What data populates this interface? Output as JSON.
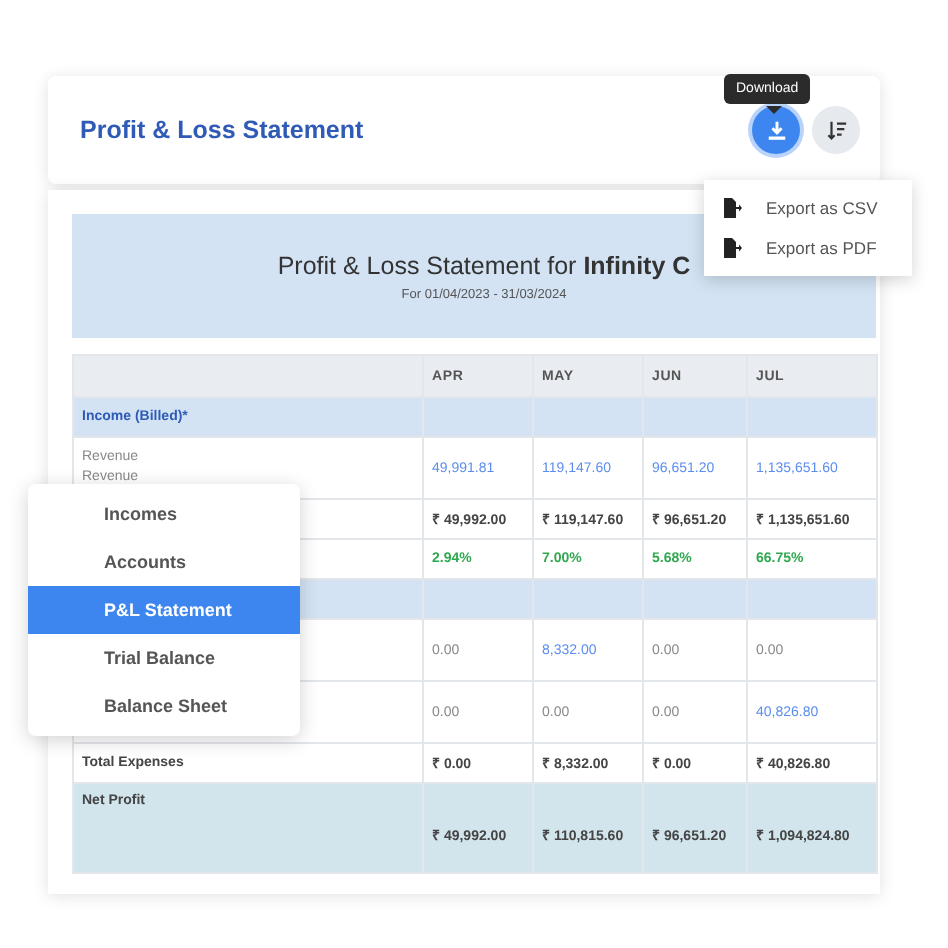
{
  "header": {
    "title": "Profit & Loss Statement",
    "tooltip": "Download",
    "buttons": [
      {
        "kind": "download",
        "active": true
      },
      {
        "kind": "sort",
        "active": false
      }
    ]
  },
  "export_menu": [
    "Export as CSV",
    "Export as PDF"
  ],
  "banner": {
    "title": "Profit & Loss Statement for **Infinity C**",
    "period": "For 01/04/2023 - 31/03/2024"
  },
  "table": {
    "columns": [
      "APR",
      "MAY",
      "JUN",
      "JUL"
    ],
    "rows": [
      {
        "kind": "section",
        "label": [
          "Income (Billed)*"
        ],
        "cells": []
      },
      {
        "kind": "detail",
        "label": [
          "Revenue",
          "Revenue"
        ],
        "cells": [
          {
            "text": "49,991.81",
            "link": true
          },
          {
            "text": "119,147.60",
            "link": true
          },
          {
            "text": "96,651.20",
            "link": true
          },
          {
            "text": "1,135,651.60",
            "link": true
          }
        ]
      },
      {
        "kind": "total",
        "label": [],
        "cells": [
          {
            "text": "₹ 49,992.00"
          },
          {
            "text": "₹ 119,147.60"
          },
          {
            "text": "₹ 96,651.20"
          },
          {
            "text": "₹ 1,135,651.60"
          }
        ]
      },
      {
        "kind": "percent",
        "label": [],
        "cells": [
          {
            "text": "2.94%"
          },
          {
            "text": "7.00%"
          },
          {
            "text": "5.68%"
          },
          {
            "text": "66.75%"
          }
        ]
      },
      {
        "kind": "section",
        "label": [],
        "cells": []
      },
      {
        "kind": "detail",
        "label": [],
        "cells": [
          {
            "text": "0.00",
            "link": false
          },
          {
            "text": "8,332.00",
            "link": true
          },
          {
            "text": "0.00",
            "link": false
          },
          {
            "text": "0.00",
            "link": false
          }
        ]
      },
      {
        "kind": "detail",
        "label": [],
        "cells": [
          {
            "text": "0.00",
            "link": false
          },
          {
            "text": "0.00",
            "link": false
          },
          {
            "text": "0.00",
            "link": false
          },
          {
            "text": "40,826.80",
            "link": true
          }
        ]
      },
      {
        "kind": "total",
        "label": [
          "Total Expenses"
        ],
        "cells": [
          {
            "text": "₹ 0.00"
          },
          {
            "text": "₹ 8,332.00"
          },
          {
            "text": "₹ 0.00"
          },
          {
            "text": "₹ 40,826.80"
          }
        ]
      },
      {
        "kind": "grand",
        "label": [
          "Net Profit"
        ],
        "cells": [
          {
            "text": "₹ 49,992.00"
          },
          {
            "text": "₹ 110,815.60"
          },
          {
            "text": "₹ 96,651.20"
          },
          {
            "text": "₹ 1,094,824.80"
          }
        ]
      }
    ]
  },
  "side_menu": [
    {
      "label": "Incomes",
      "selected": false
    },
    {
      "label": "Accounts",
      "selected": false
    },
    {
      "label": "P&L Statement",
      "selected": true
    },
    {
      "label": "Trial Balance",
      "selected": false
    },
    {
      "label": "Balance Sheet",
      "selected": false
    }
  ]
}
